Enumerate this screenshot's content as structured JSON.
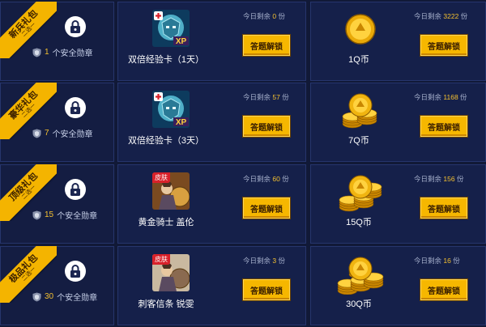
{
  "rows": [
    {
      "ribbon_title": "新兵礼包",
      "ribbon_sub": "二选一",
      "medal_count": "1",
      "medal_text": "个安全勋章",
      "item_name": "双倍经验卡（1天）",
      "item_remain_prefix": "今日剩余",
      "item_remain": "0",
      "item_remain_unit": "份",
      "item_button": "答题解锁",
      "coin_name": "1Q币",
      "coin_remain_prefix": "今日剩余",
      "coin_remain": "3222",
      "coin_remain_unit": "份",
      "coin_button": "答题解锁"
    },
    {
      "ribbon_title": "豪华礼包",
      "ribbon_sub": "二选一",
      "medal_count": "7",
      "medal_text": "个安全勋章",
      "item_name": "双倍经验卡（3天）",
      "item_remain_prefix": "今日剩余",
      "item_remain": "57",
      "item_remain_unit": "份",
      "item_button": "答题解锁",
      "coin_name": "7Q币",
      "coin_remain_prefix": "今日剩余",
      "coin_remain": "1168",
      "coin_remain_unit": "份",
      "coin_button": "答题解锁"
    },
    {
      "ribbon_title": "顶级礼包",
      "ribbon_sub": "二选一",
      "medal_count": "15",
      "medal_text": "个安全勋章",
      "item_badge": "皮肤",
      "item_name": "黄金骑士 盖伦",
      "item_remain_prefix": "今日剩余",
      "item_remain": "60",
      "item_remain_unit": "份",
      "item_button": "答题解锁",
      "coin_name": "15Q币",
      "coin_remain_prefix": "今日剩余",
      "coin_remain": "156",
      "coin_remain_unit": "份",
      "coin_button": "答题解锁"
    },
    {
      "ribbon_title": "极品礼包",
      "ribbon_sub": "二选一",
      "medal_count": "30",
      "medal_text": "个安全勋章",
      "item_badge": "皮肤",
      "item_name": "刺客信条 锐雯",
      "item_remain_prefix": "今日剩余",
      "item_remain": "3",
      "item_remain_unit": "份",
      "item_button": "答题解锁",
      "coin_name": "30Q币",
      "coin_remain_prefix": "今日剩余",
      "coin_remain": "16",
      "coin_remain_unit": "份",
      "coin_button": "答题解锁"
    }
  ],
  "exp_card_label": "XP",
  "colors": {
    "accent": "#f6b700",
    "background": "#0b1026",
    "panel": "#15204a",
    "highlight_number": "#f4c030"
  }
}
